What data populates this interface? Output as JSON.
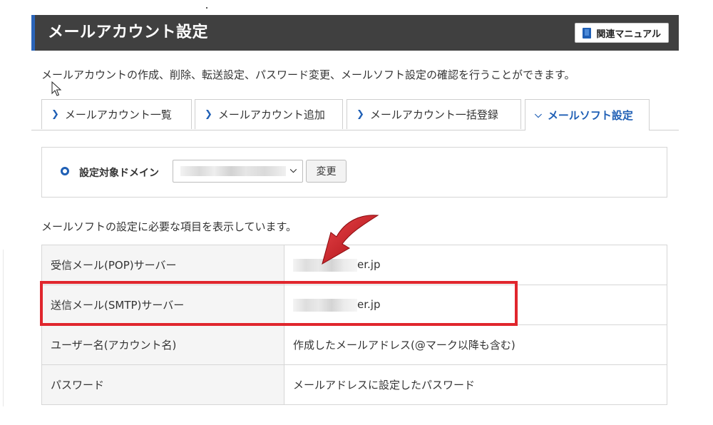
{
  "header": {
    "title": "メールアカウント設定",
    "manual_label": "関連マニュアル"
  },
  "description": "メールアカウントの作成、削除、転送設定、パスワード変更、メールソフト設定の確認を行うことができます。",
  "tabs": [
    {
      "label": "メールアカウント一覧",
      "active": false
    },
    {
      "label": "メールアカウント追加",
      "active": false
    },
    {
      "label": "メールアカウント一括登録",
      "active": false
    },
    {
      "label": "メールソフト設定",
      "active": true
    }
  ],
  "domain_selector": {
    "label": "設定対象ドメイン",
    "change_label": "変更"
  },
  "info_text": "メールソフトの設定に必要な項目を表示しています。",
  "settings": [
    {
      "label": "受信メール(POP)サーバー",
      "value": "er.jp"
    },
    {
      "label": "送信メール(SMTP)サーバー",
      "value": "er.jp"
    },
    {
      "label": "ユーザー名(アカウント名)",
      "value": "作成したメールアドレス(@マーク以降も含む)"
    },
    {
      "label": "パスワード",
      "value": "メールアドレスに設定したパスワード"
    }
  ],
  "colors": {
    "header_bg": "#404040",
    "accent": "#1f5fb5",
    "highlight": "#e0262d",
    "arrow": "#c8141a"
  }
}
